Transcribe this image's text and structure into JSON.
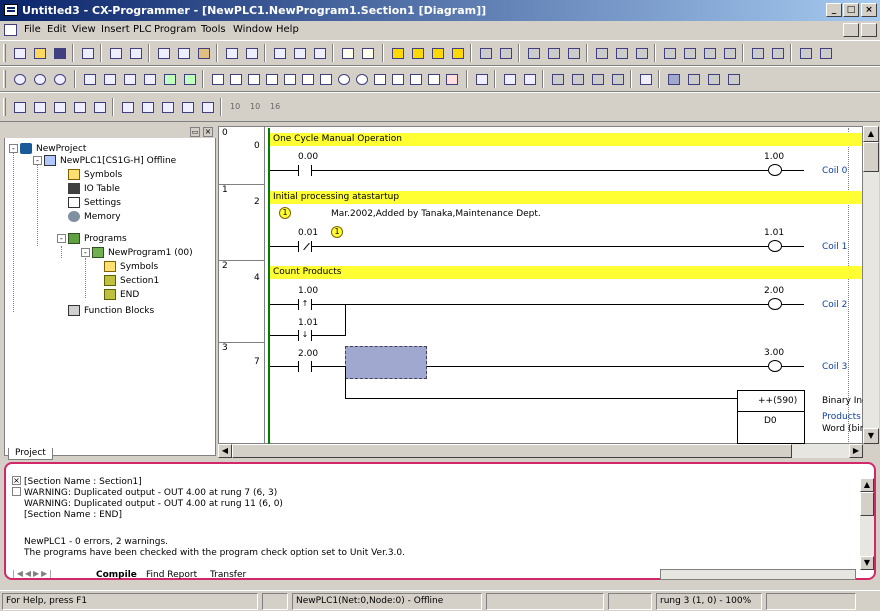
{
  "window": {
    "title": "Untitled3 - CX-Programmer - [NewPLC1.NewProgram1.Section1 [Diagram]]",
    "min": "_",
    "max": "□",
    "close": "×"
  },
  "menu": [
    "File",
    "Edit",
    "View",
    "Insert",
    "PLC",
    "Program",
    "Tools",
    "Window",
    "Help"
  ],
  "tree": {
    "root": "NewProject",
    "plc": "NewPLC1[CS1G-H] Offline",
    "items": [
      "Symbols",
      "IO Table",
      "Settings",
      "Memory",
      "Programs",
      "NewProgram1 (00)",
      "Symbols",
      "Section1",
      "END",
      "Function Blocks"
    ]
  },
  "rungs": [
    {
      "num": "0",
      "step": "0",
      "title": "One Cycle Manual Operation",
      "in_addr": "0.00",
      "out_addr": "1.00",
      "coil": "Coil 0"
    },
    {
      "num": "1",
      "step": "2",
      "title": "Initial processing atastartup",
      "note": "Mar.2002,Added by Tanaka,Maintenance Dept.",
      "note_mark": "1",
      "in_addr": "0.01",
      "out_addr": "1.01",
      "coil": "Coil 1"
    },
    {
      "num": "2",
      "step": "4",
      "title": "Count Products",
      "in_addr": "1.00",
      "in_addr2": "1.01",
      "out_addr": "2.00",
      "coil": "Coil 2"
    },
    {
      "num": "3",
      "step": "7",
      "in_addr": "2.00",
      "out_addr": "3.00",
      "coil": "Coil 3",
      "fb_name": "++(590)",
      "fb_op": "D0",
      "fb_label1": "Binary Inc",
      "fb_label2": "Products",
      "fb_label3": "Word (bin"
    }
  ],
  "project_tab": "Project",
  "output": {
    "lines": [
      "[Section Name : Section1]",
      "WARNING: Duplicated output - OUT 4.00 at rung 7 (6, 3)",
      "WARNING: Duplicated output - OUT 4.00 at rung 11 (6, 0)",
      "[Section Name : END]",
      "",
      "NewPLC1 - 0 errors, 2 warnings.",
      "The programs have been checked with the program check option set to Unit Ver.3.0."
    ],
    "tabs": [
      "Compile",
      "Find Report",
      "Transfer"
    ]
  },
  "status": {
    "help": "For Help, press F1",
    "plc": "NewPLC1(Net:0,Node:0) - Offline",
    "pos": "rung 3 (1, 0) - 100%"
  },
  "colors": {
    "highlight": "#d1286a",
    "comment_bar": "#ffff33",
    "rail": "#008000",
    "selection": "#a0a8d0"
  }
}
